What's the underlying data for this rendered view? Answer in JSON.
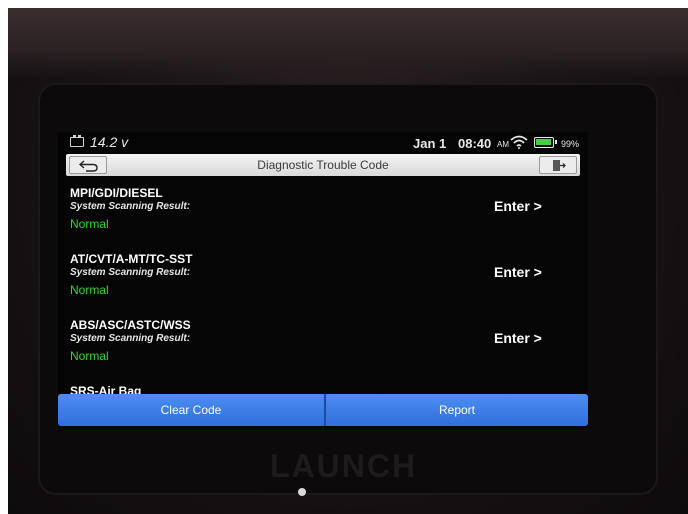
{
  "device": {
    "brand": "LAUNCH"
  },
  "status_bar": {
    "voltage": "14.2 v",
    "date": "Jan 1",
    "time": "08:40",
    "ampm": "AM",
    "battery_percent": "99%",
    "battery_level": 0.99,
    "icons": [
      "battery-voltage-icon",
      "wifi-icon",
      "battery-icon"
    ]
  },
  "title_bar": {
    "title": "Diagnostic Trouble Code",
    "icons": [
      "back-arrow-icon",
      "exit-icon"
    ]
  },
  "systems": [
    {
      "name": "MPI/GDI/DIESEL",
      "label": "System Scanning Result:",
      "status": "Normal",
      "action": "Enter >"
    },
    {
      "name": "AT/CVT/A-MT/TC-SST",
      "label": "System Scanning Result:",
      "status": "Normal",
      "action": "Enter >"
    },
    {
      "name": "ABS/ASC/ASTC/WSS",
      "label": "System Scanning Result:",
      "status": "Normal",
      "action": "Enter >"
    },
    {
      "name": "SRS-Air Bag"
    }
  ],
  "actions": {
    "clear_code": "Clear Code",
    "report": "Report"
  },
  "colors": {
    "normal_status": "#35d435",
    "button_blue": "#3b7ce8",
    "screen_bg": "#050505"
  }
}
